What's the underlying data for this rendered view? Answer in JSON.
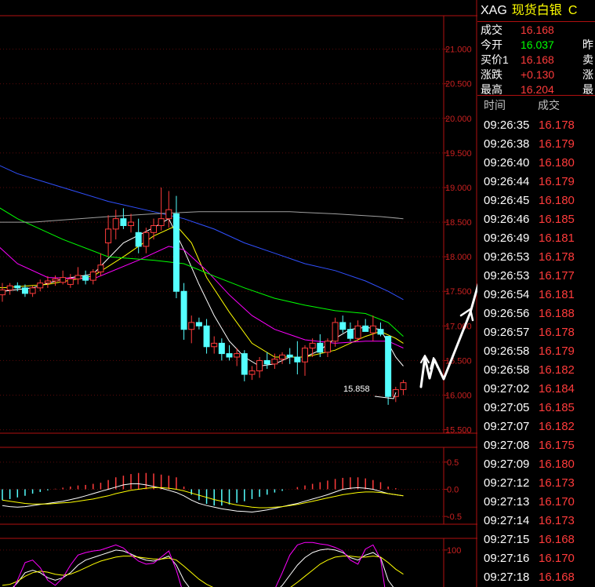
{
  "header": {
    "symbol": "XAG",
    "name": "现货白银",
    "code_fragment": "C"
  },
  "quote": {
    "rows": [
      {
        "label": "成交",
        "value": "16.168",
        "color": "#ff3b3b",
        "right": ""
      },
      {
        "label": "今开",
        "value": "16.037",
        "color": "#00ff00",
        "right": "昨"
      },
      {
        "label": "买价1",
        "value": "16.168",
        "color": "#ff3b3b",
        "right": "卖"
      },
      {
        "label": "涨跌",
        "value": "+0.130",
        "color": "#ff3b3b",
        "right": "涨"
      },
      {
        "label": "最高",
        "value": "16.204",
        "color": "#ff3b3b",
        "right": "最"
      }
    ]
  },
  "ticks": {
    "col_time": "时间",
    "col_price": "成交",
    "rows": [
      {
        "time": "09:26:35",
        "price": "16.178"
      },
      {
        "time": "09:26:38",
        "price": "16.179"
      },
      {
        "time": "09:26:40",
        "price": "16.180"
      },
      {
        "time": "09:26:44",
        "price": "16.179"
      },
      {
        "time": "09:26:45",
        "price": "16.180"
      },
      {
        "time": "09:26:46",
        "price": "16.185"
      },
      {
        "time": "09:26:49",
        "price": "16.181"
      },
      {
        "time": "09:26:53",
        "price": "16.178"
      },
      {
        "time": "09:26:53",
        "price": "16.177"
      },
      {
        "time": "09:26:54",
        "price": "16.181"
      },
      {
        "time": "09:26:56",
        "price": "16.188"
      },
      {
        "time": "09:26:57",
        "price": "16.178"
      },
      {
        "time": "09:26:58",
        "price": "16.179"
      },
      {
        "time": "09:26:58",
        "price": "16.182"
      },
      {
        "time": "09:27:02",
        "price": "16.184"
      },
      {
        "time": "09:27:05",
        "price": "16.185"
      },
      {
        "time": "09:27:07",
        "price": "16.182"
      },
      {
        "time": "09:27:08",
        "price": "16.175"
      },
      {
        "time": "09:27:09",
        "price": "16.180"
      },
      {
        "time": "09:27:12",
        "price": "16.173"
      },
      {
        "time": "09:27:13",
        "price": "16.170"
      },
      {
        "time": "09:27:14",
        "price": "16.173"
      },
      {
        "time": "09:27:15",
        "price": "16.168"
      },
      {
        "time": "09:27:16",
        "price": "16.170"
      },
      {
        "time": "09:27:18",
        "price": "16.168"
      }
    ]
  },
  "chart_data": {
    "type": "candlestick",
    "price_axis": {
      "ticks": [
        "21.000",
        "20.500",
        "20.000",
        "19.500",
        "19.000",
        "18.500",
        "18.000",
        "17.500",
        "17.000",
        "16.500",
        "16.000",
        "15.500"
      ],
      "ylim": [
        15.45,
        21.2
      ]
    },
    "macd_axis": {
      "ticks": [
        "0.5",
        "0.0",
        "-0.5"
      ],
      "ylim": [
        -0.6,
        0.7
      ]
    },
    "kdj_axis": {
      "ticks": [
        "100"
      ],
      "ylim": [
        -20,
        120
      ]
    },
    "low_annotation": "15.858",
    "candles": [
      {
        "o": 17.45,
        "h": 17.62,
        "l": 17.35,
        "c": 17.52
      },
      {
        "o": 17.52,
        "h": 17.62,
        "l": 17.45,
        "c": 17.58
      },
      {
        "o": 17.58,
        "h": 17.63,
        "l": 17.5,
        "c": 17.55
      },
      {
        "o": 17.55,
        "h": 17.6,
        "l": 17.42,
        "c": 17.47
      },
      {
        "o": 17.47,
        "h": 17.58,
        "l": 17.42,
        "c": 17.55
      },
      {
        "o": 17.55,
        "h": 17.67,
        "l": 17.5,
        "c": 17.62
      },
      {
        "o": 17.62,
        "h": 17.72,
        "l": 17.55,
        "c": 17.65
      },
      {
        "o": 17.65,
        "h": 17.73,
        "l": 17.58,
        "c": 17.68
      },
      {
        "o": 17.63,
        "h": 17.8,
        "l": 17.6,
        "c": 17.7
      },
      {
        "o": 17.6,
        "h": 17.75,
        "l": 17.55,
        "c": 17.68
      },
      {
        "o": 17.68,
        "h": 17.85,
        "l": 17.6,
        "c": 17.73
      },
      {
        "o": 17.72,
        "h": 17.8,
        "l": 17.6,
        "c": 17.66
      },
      {
        "o": 17.66,
        "h": 17.82,
        "l": 17.6,
        "c": 17.78
      },
      {
        "o": 17.78,
        "h": 18.05,
        "l": 17.72,
        "c": 17.88
      },
      {
        "o": 18.2,
        "h": 18.6,
        "l": 18.0,
        "c": 18.4
      },
      {
        "o": 18.4,
        "h": 18.68,
        "l": 18.25,
        "c": 18.55
      },
      {
        "o": 18.55,
        "h": 18.7,
        "l": 18.4,
        "c": 18.45
      },
      {
        "o": 18.45,
        "h": 18.62,
        "l": 18.35,
        "c": 18.5
      },
      {
        "o": 18.35,
        "h": 18.55,
        "l": 18.05,
        "c": 18.15
      },
      {
        "o": 18.15,
        "h": 18.42,
        "l": 18.05,
        "c": 18.35
      },
      {
        "o": 18.35,
        "h": 18.55,
        "l": 18.25,
        "c": 18.45
      },
      {
        "o": 18.45,
        "h": 19.0,
        "l": 18.38,
        "c": 18.55
      },
      {
        "o": 18.55,
        "h": 18.95,
        "l": 18.42,
        "c": 18.68
      },
      {
        "o": 18.62,
        "h": 18.88,
        "l": 17.4,
        "c": 17.5
      },
      {
        "o": 17.5,
        "h": 17.62,
        "l": 16.8,
        "c": 16.95
      },
      {
        "o": 16.95,
        "h": 17.15,
        "l": 16.75,
        "c": 17.05
      },
      {
        "o": 17.05,
        "h": 17.12,
        "l": 16.95,
        "c": 17.0
      },
      {
        "o": 17.0,
        "h": 17.1,
        "l": 16.6,
        "c": 16.7
      },
      {
        "o": 16.7,
        "h": 16.85,
        "l": 16.6,
        "c": 16.75
      },
      {
        "o": 16.75,
        "h": 16.82,
        "l": 16.5,
        "c": 16.6
      },
      {
        "o": 16.6,
        "h": 16.72,
        "l": 16.5,
        "c": 16.55
      },
      {
        "o": 16.55,
        "h": 16.68,
        "l": 16.42,
        "c": 16.6
      },
      {
        "o": 16.6,
        "h": 16.65,
        "l": 16.2,
        "c": 16.3
      },
      {
        "o": 16.3,
        "h": 16.42,
        "l": 16.22,
        "c": 16.35
      },
      {
        "o": 16.35,
        "h": 16.55,
        "l": 16.25,
        "c": 16.5
      },
      {
        "o": 16.5,
        "h": 16.62,
        "l": 16.38,
        "c": 16.45
      },
      {
        "o": 16.45,
        "h": 16.6,
        "l": 16.38,
        "c": 16.52
      },
      {
        "o": 16.52,
        "h": 16.62,
        "l": 16.45,
        "c": 16.58
      },
      {
        "o": 16.58,
        "h": 16.68,
        "l": 16.45,
        "c": 16.55
      },
      {
        "o": 16.55,
        "h": 16.78,
        "l": 16.3,
        "c": 16.48
      },
      {
        "o": 16.48,
        "h": 16.72,
        "l": 16.28,
        "c": 16.68
      },
      {
        "o": 16.68,
        "h": 16.82,
        "l": 16.55,
        "c": 16.75
      },
      {
        "o": 16.75,
        "h": 16.88,
        "l": 16.55,
        "c": 16.62
      },
      {
        "o": 16.62,
        "h": 16.82,
        "l": 16.55,
        "c": 16.78
      },
      {
        "o": 16.78,
        "h": 17.12,
        "l": 16.7,
        "c": 17.05
      },
      {
        "o": 17.05,
        "h": 17.15,
        "l": 16.9,
        "c": 16.95
      },
      {
        "o": 16.95,
        "h": 17.05,
        "l": 16.78,
        "c": 16.82
      },
      {
        "o": 16.82,
        "h": 17.08,
        "l": 16.78,
        "c": 17.0
      },
      {
        "o": 17.0,
        "h": 17.1,
        "l": 16.92,
        "c": 16.92
      },
      {
        "o": 16.9,
        "h": 17.15,
        "l": 16.78,
        "c": 17.0
      },
      {
        "o": 16.95,
        "h": 17.05,
        "l": 16.85,
        "c": 16.88
      },
      {
        "o": 16.85,
        "h": 16.85,
        "l": 15.86,
        "c": 15.98
      },
      {
        "o": 15.98,
        "h": 16.12,
        "l": 15.9,
        "c": 16.08
      },
      {
        "o": 16.08,
        "h": 16.22,
        "l": 16.0,
        "c": 16.18
      }
    ],
    "ma_lines": [
      {
        "color": "#ffffff",
        "points": [
          [
            -10,
            17.7
          ],
          [
            0,
            17.5
          ],
          [
            4,
            17.55
          ],
          [
            8,
            17.68
          ],
          [
            12,
            17.75
          ],
          [
            16,
            18.2
          ],
          [
            20,
            18.42
          ],
          [
            22,
            18.55
          ],
          [
            24,
            18.1
          ],
          [
            26,
            17.6
          ],
          [
            28,
            17.15
          ],
          [
            30,
            16.78
          ],
          [
            32,
            16.55
          ],
          [
            34,
            16.42
          ],
          [
            36,
            16.45
          ],
          [
            38,
            16.55
          ],
          [
            40,
            16.55
          ],
          [
            42,
            16.65
          ],
          [
            44,
            16.82
          ],
          [
            46,
            16.95
          ],
          [
            48,
            16.98
          ],
          [
            50,
            16.95
          ],
          [
            52,
            16.55
          ],
          [
            53,
            16.42
          ]
        ]
      },
      {
        "color": "#ffff00",
        "points": [
          [
            -10,
            18.3
          ],
          [
            -4,
            17.6
          ],
          [
            0,
            17.55
          ],
          [
            6,
            17.6
          ],
          [
            12,
            17.72
          ],
          [
            16,
            18.0
          ],
          [
            20,
            18.3
          ],
          [
            23,
            18.45
          ],
          [
            25,
            18.2
          ],
          [
            27,
            17.7
          ],
          [
            30,
            17.2
          ],
          [
            33,
            16.75
          ],
          [
            36,
            16.55
          ],
          [
            40,
            16.55
          ],
          [
            44,
            16.65
          ],
          [
            48,
            16.85
          ],
          [
            50,
            16.92
          ],
          [
            52,
            16.82
          ],
          [
            53,
            16.75
          ]
        ]
      },
      {
        "color": "#ff00ff",
        "points": [
          [
            -10,
            18.9
          ],
          [
            -2,
            18.3
          ],
          [
            2,
            17.9
          ],
          [
            6,
            17.7
          ],
          [
            12,
            17.68
          ],
          [
            18,
            17.95
          ],
          [
            22,
            18.15
          ],
          [
            24,
            18.1
          ],
          [
            27,
            17.8
          ],
          [
            30,
            17.45
          ],
          [
            33,
            17.15
          ],
          [
            36,
            16.95
          ],
          [
            40,
            16.8
          ],
          [
            44,
            16.75
          ],
          [
            48,
            16.78
          ],
          [
            51,
            16.78
          ],
          [
            53,
            16.68
          ]
        ]
      },
      {
        "color": "#00ff00",
        "points": [
          [
            -10,
            19.3
          ],
          [
            -4,
            18.95
          ],
          [
            2,
            18.55
          ],
          [
            8,
            18.25
          ],
          [
            14,
            18.0
          ],
          [
            20,
            17.95
          ],
          [
            24,
            17.9
          ],
          [
            28,
            17.72
          ],
          [
            32,
            17.55
          ],
          [
            36,
            17.4
          ],
          [
            40,
            17.3
          ],
          [
            44,
            17.22
          ],
          [
            48,
            17.18
          ],
          [
            51,
            17.05
          ],
          [
            53,
            16.85
          ]
        ]
      },
      {
        "color": "#3050ff",
        "points": [
          [
            -10,
            19.85
          ],
          [
            -4,
            19.5
          ],
          [
            2,
            19.2
          ],
          [
            8,
            19.0
          ],
          [
            14,
            18.8
          ],
          [
            20,
            18.65
          ],
          [
            24,
            18.55
          ],
          [
            28,
            18.4
          ],
          [
            32,
            18.2
          ],
          [
            36,
            18.05
          ],
          [
            40,
            17.9
          ],
          [
            44,
            17.8
          ],
          [
            48,
            17.65
          ],
          [
            51,
            17.5
          ],
          [
            53,
            17.38
          ]
        ]
      },
      {
        "color": "#a0a0a0",
        "points": [
          [
            -10,
            18.5
          ],
          [
            4,
            18.5
          ],
          [
            14,
            18.58
          ],
          [
            20,
            18.62
          ],
          [
            26,
            18.65
          ],
          [
            32,
            18.65
          ],
          [
            38,
            18.65
          ],
          [
            44,
            18.62
          ],
          [
            50,
            18.58
          ],
          [
            53,
            18.55
          ]
        ]
      }
    ],
    "macd_hist": [
      -0.2,
      -0.18,
      -0.15,
      -0.12,
      -0.08,
      -0.05,
      -0.02,
      0.01,
      0.03,
      0.05,
      0.07,
      0.08,
      0.1,
      0.12,
      0.17,
      0.22,
      0.25,
      0.28,
      0.3,
      0.3,
      0.29,
      0.27,
      0.25,
      0.22,
      0.05,
      -0.1,
      -0.2,
      -0.27,
      -0.3,
      -0.3,
      -0.28,
      -0.25,
      -0.22,
      -0.18,
      -0.14,
      -0.1,
      -0.06,
      -0.03,
      0.0,
      0.04,
      0.07,
      0.1,
      0.13,
      0.16,
      0.19,
      0.21,
      0.22,
      0.22,
      0.2,
      0.17,
      0.13,
      0.05,
      0.02,
      0.0
    ],
    "macd_lines": [
      {
        "color": "#ffffff",
        "values": [
          -0.3,
          -0.32,
          -0.33,
          -0.32,
          -0.3,
          -0.28,
          -0.26,
          -0.24,
          -0.22,
          -0.19,
          -0.16,
          -0.12,
          -0.08,
          -0.04,
          0.0,
          0.04,
          0.08,
          0.1,
          0.1,
          0.08,
          0.05,
          0.02,
          -0.02,
          -0.06,
          -0.12,
          -0.2,
          -0.26,
          -0.3,
          -0.33,
          -0.36,
          -0.38,
          -0.4,
          -0.41,
          -0.42,
          -0.4,
          -0.38,
          -0.35,
          -0.32,
          -0.29,
          -0.26,
          -0.22,
          -0.18,
          -0.14,
          -0.1,
          -0.05,
          0.0,
          0.02,
          0.03,
          0.02,
          0.0,
          -0.04,
          -0.08,
          -0.1,
          -0.12
        ]
      },
      {
        "color": "#ffff00",
        "values": [
          -0.2,
          -0.22,
          -0.24,
          -0.26,
          -0.27,
          -0.27,
          -0.27,
          -0.26,
          -0.25,
          -0.24,
          -0.22,
          -0.2,
          -0.18,
          -0.15,
          -0.12,
          -0.08,
          -0.05,
          -0.02,
          0.0,
          0.02,
          0.03,
          0.03,
          0.02,
          0.0,
          -0.03,
          -0.07,
          -0.11,
          -0.15,
          -0.19,
          -0.22,
          -0.26,
          -0.29,
          -0.31,
          -0.33,
          -0.34,
          -0.34,
          -0.33,
          -0.32,
          -0.3,
          -0.28,
          -0.25,
          -0.22,
          -0.19,
          -0.16,
          -0.13,
          -0.1,
          -0.08,
          -0.06,
          -0.05,
          -0.05,
          -0.06,
          -0.08,
          -0.1,
          -0.12
        ]
      }
    ],
    "kdj_lines": [
      {
        "color": "#ffffff",
        "values": [
          10,
          20,
          35,
          55,
          60,
          55,
          45,
          40,
          45,
          55,
          70,
          80,
          85,
          90,
          95,
          100,
          98,
          92,
          85,
          80,
          78,
          82,
          88,
          70,
          40,
          20,
          10,
          5,
          8,
          10,
          12,
          12,
          10,
          8,
          5,
          5,
          15,
          30,
          50,
          70,
          85,
          95,
          100,
          102,
          100,
          95,
          85,
          80,
          90,
          95,
          85,
          40,
          20,
          15
        ]
      },
      {
        "color": "#ffff00",
        "values": [
          30,
          32,
          38,
          48,
          55,
          58,
          56,
          52,
          50,
          52,
          58,
          65,
          72,
          78,
          82,
          86,
          88,
          88,
          86,
          84,
          82,
          82,
          84,
          80,
          68,
          55,
          42,
          32,
          25,
          20,
          17,
          15,
          13,
          11,
          9,
          8,
          10,
          16,
          25,
          36,
          48,
          60,
          72,
          80,
          86,
          88,
          88,
          86,
          86,
          88,
          86,
          75,
          62,
          52
        ]
      },
      {
        "color": "#ff00ff",
        "values": [
          0,
          10,
          40,
          75,
          80,
          65,
          40,
          30,
          45,
          70,
          90,
          95,
          98,
          100,
          105,
          110,
          104,
          90,
          78,
          72,
          74,
          86,
          98,
          60,
          10,
          -5,
          -10,
          -12,
          -5,
          0,
          5,
          8,
          5,
          0,
          -5,
          -3,
          22,
          55,
          90,
          110,
          115,
          115,
          112,
          110,
          105,
          98,
          80,
          72,
          102,
          110,
          82,
          -20,
          -25,
          -20
        ]
      }
    ]
  }
}
